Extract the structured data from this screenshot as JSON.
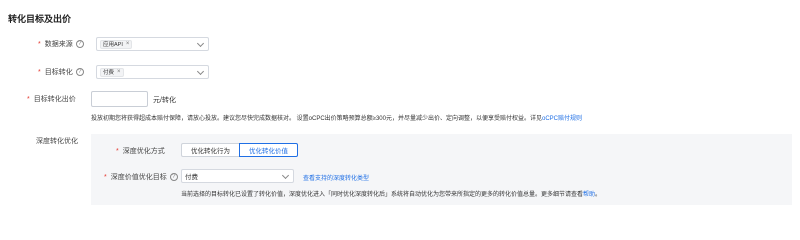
{
  "section_title": "转化目标及出价",
  "data_source": {
    "label": "数据来源",
    "tag": "应用API",
    "tag_close": "×"
  },
  "target_conversion": {
    "label": "目标转化",
    "tag": "付费",
    "tag_close": "×"
  },
  "target_bid": {
    "label": "目标转化出价",
    "value": "",
    "unit": "元/转化"
  },
  "bid_note": {
    "text": "投放初期您将获得超成本赔付保障，请放心投放。建议您尽快完成数据核对。 设置oCPC出价策略预算总额≥300元，并尽量减少出价、定向调整，以便享受赔付权益。详见",
    "link": "oCPC赔付规则"
  },
  "deep_optimization": {
    "label": "深度转化优化",
    "mode": {
      "label": "深度优化方式",
      "options": [
        "优化转化行为",
        "优化转化价值"
      ],
      "selected": "优化转化价值"
    },
    "deep_target": {
      "label": "深度价值优化目标",
      "value": "付费",
      "link": "查看支持的深度转化类型"
    },
    "note_text": "当前选择的目标转化已设置了转化价值，深度优化进入「同时优化深度转化后」系统将自动优化为您带来所指定的更多的转化价值总量。更多细节请查看",
    "note_link": "帮助",
    "note_end": "。"
  },
  "colors": {
    "required": "#e5372e",
    "link": "#1f6fe5",
    "panel_bg": "#f5f6f8"
  }
}
